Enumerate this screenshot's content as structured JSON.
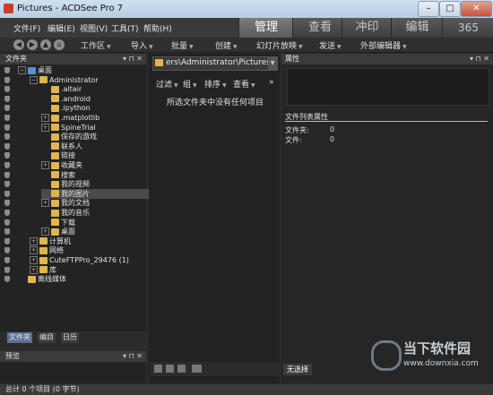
{
  "window": {
    "title": "Pictures - ACDSee Pro 7",
    "controls": [
      "–",
      "□",
      "✕"
    ]
  },
  "menu": [
    "文件(F)",
    "编辑(E)",
    "视图(V)",
    "工具(T)",
    "帮助(H)"
  ],
  "mode_tabs": [
    "管理",
    "查看",
    "冲印",
    "编辑",
    "365"
  ],
  "toolbar": [
    "工作区",
    "导入",
    "批量",
    "创建",
    "幻灯片放映",
    "发送",
    "外部编辑器"
  ],
  "folder_panel": {
    "title": "文件夹"
  },
  "folder_tree": [
    {
      "label": "桌面",
      "level": 0,
      "expander": "−"
    },
    {
      "label": "Administrator",
      "level": 1,
      "expander": "−"
    },
    {
      "label": ".altair",
      "level": 2,
      "expander": ""
    },
    {
      "label": ".android",
      "level": 2,
      "expander": ""
    },
    {
      "label": ".ipython",
      "level": 2,
      "expander": ""
    },
    {
      "label": ".matplotlib",
      "level": 2,
      "expander": "+"
    },
    {
      "label": "SpineTrial",
      "level": 2,
      "expander": "+"
    },
    {
      "label": "保存的游戏",
      "level": 2,
      "expander": ""
    },
    {
      "label": "联系人",
      "level": 2,
      "expander": ""
    },
    {
      "label": "链接",
      "level": 2,
      "expander": ""
    },
    {
      "label": "收藏夹",
      "level": 2,
      "expander": "+"
    },
    {
      "label": "搜索",
      "level": 2,
      "expander": ""
    },
    {
      "label": "我的视频",
      "level": 2,
      "expander": ""
    },
    {
      "label": "我的图片",
      "level": 2,
      "expander": "",
      "selected": true
    },
    {
      "label": "我的文档",
      "level": 2,
      "expander": "+"
    },
    {
      "label": "我的音乐",
      "level": 2,
      "expander": ""
    },
    {
      "label": "下载",
      "level": 2,
      "expander": ""
    },
    {
      "label": "桌面",
      "level": 2,
      "expander": "+"
    },
    {
      "label": "计算机",
      "level": 1,
      "expander": "+"
    },
    {
      "label": "网络",
      "level": 1,
      "expander": "+"
    },
    {
      "label": "CuteFTPPro_29476 (1)",
      "level": 1,
      "expander": "+"
    },
    {
      "label": "库",
      "level": 1,
      "expander": "+"
    },
    {
      "label": "离线媒体",
      "level": 0,
      "expander": ""
    }
  ],
  "bottom_tabs": [
    "文件夹",
    "编目",
    "日历"
  ],
  "preview_panel": {
    "title": "预览"
  },
  "path": {
    "value": "ers\\Administrator\\Pictures"
  },
  "content_toolbar": [
    "过滤",
    "组",
    "排序",
    "查看"
  ],
  "empty_message": "所选文件夹中没有任何项目",
  "properties_panel": {
    "title": "属性",
    "section": "文件列表属性",
    "rows": [
      {
        "label": "文件夹:",
        "value": "0"
      },
      {
        "label": "文件:",
        "value": "0"
      }
    ],
    "tab": "无选择"
  },
  "status": "总计 0 个项目 (0 字节)",
  "watermark": {
    "title": "当下软件园",
    "url": "www.downxia.com"
  }
}
